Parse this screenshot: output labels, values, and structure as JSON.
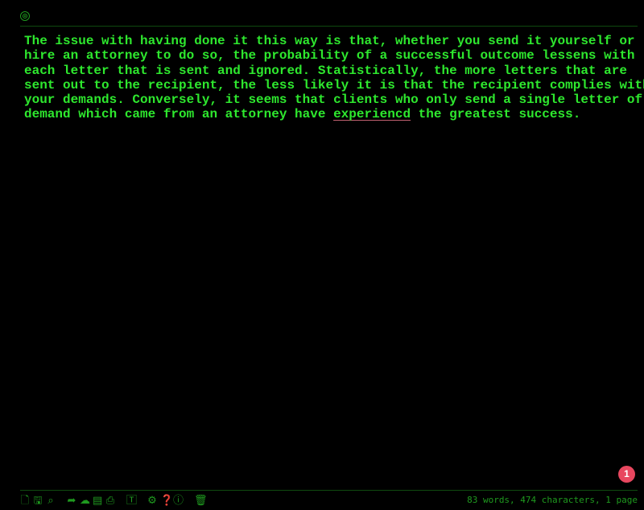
{
  "editor": {
    "lines": [
      "The issue with having done it this way is that, whether you send it yourself or",
      "hire an attorney to do so, the probability of a successful outcome lessens with",
      "each letter that is sent and ignored. Statistically, the more letters that are",
      "sent out to the recipient, the less likely it is that the recipient complies with",
      "your demands. Conversely, it seems that clients who only send a single letter of"
    ],
    "last_line_before": "demand which came from an attorney have ",
    "misspelled_word": "experiencd",
    "last_line_after": " the greatest success."
  },
  "toolbar": {
    "icons": [
      "new-file-icon",
      "save-icon",
      "search-icon",
      "share-icon",
      "cloud-download-icon",
      "pdf-icon",
      "print-icon",
      "text-format-icon",
      "settings-icon",
      "help-icon",
      "info-icon",
      "trash-icon"
    ]
  },
  "status": {
    "text": "83 words, 474 characters, 1 page"
  },
  "notification": {
    "count": "1"
  },
  "colors": {
    "text": "#2ee82e",
    "ui": "#1f9a1f",
    "background": "#000000",
    "badge": "#e8475f"
  }
}
